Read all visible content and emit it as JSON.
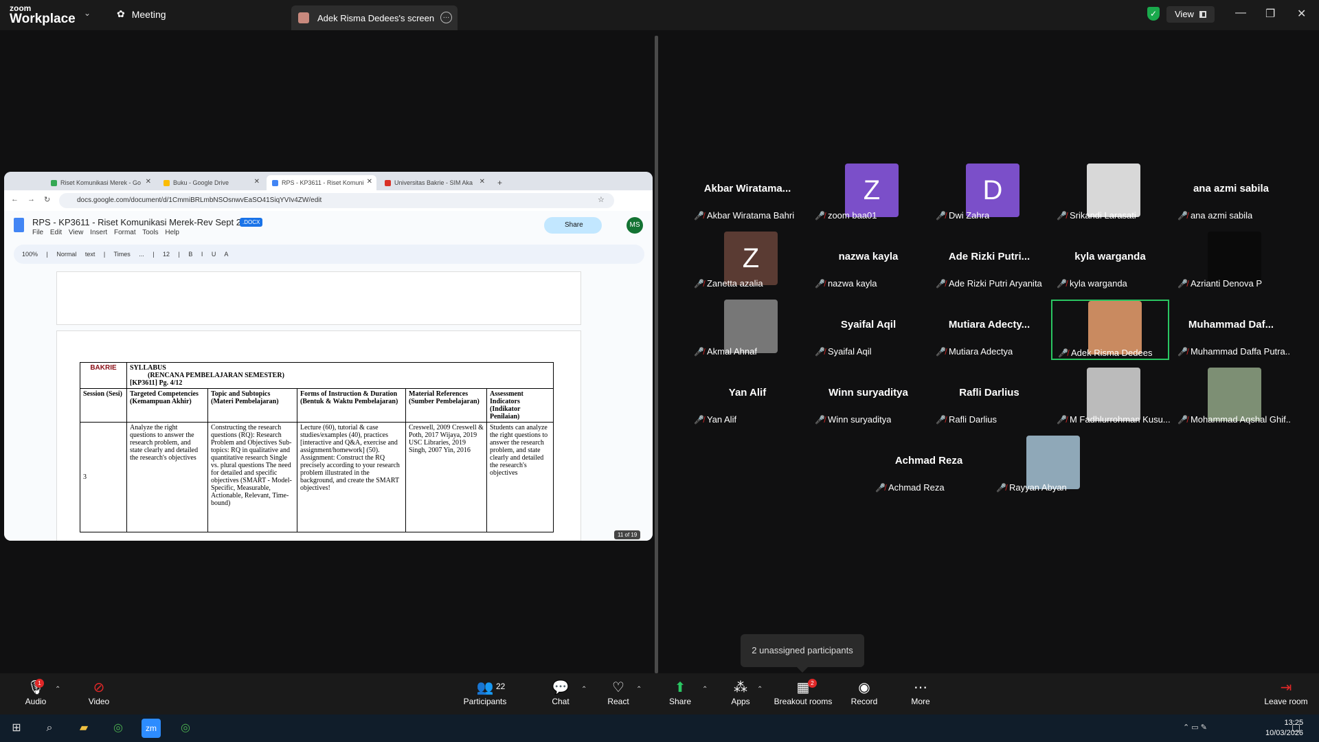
{
  "titlebar": {
    "logo_top": "zoom",
    "logo_bottom": "Workplace",
    "meeting_tab": "Meeting",
    "screen_tab": "Adek Risma Dedees's screen",
    "view_label": "View"
  },
  "browser": {
    "tabs": [
      "Riset Komunikasi Merek - Go",
      "Buku - Google Drive",
      "RPS - KP3611 - Riset Komuni",
      "Universitas Bakrie - SIM Aka"
    ],
    "url": "docs.google.com/document/d/1CmmiBRLmbNSOsnwvEaSO41SiqYVIv4ZW/edit"
  },
  "doc": {
    "title": "RPS - KP3611 - Riset Komunikasi Merek-Rev Sept 2025",
    "badge": ".DOCX",
    "menus": "File Edit View Insert Format Tools Help",
    "share_label": "Share",
    "avatar": "MS",
    "toolbar": "100% | Normal text | Times ... | 12 | B I U A",
    "page_count": "11 of 19",
    "syllabus": {
      "logo_text": "BAKRIE",
      "heading1": "SYLLABUS",
      "heading2": "(RENCANA PEMBELAJARAN SEMESTER)",
      "heading3": "[KP3611] Pg. 4/12",
      "headers": [
        "Session (Sesi)",
        "Targeted Competencies (Kemampuan Akhir)",
        "Topic and Subtopics (Materi Pembelajaran)",
        "Forms of Instruction & Duration (Bentuk & Waktu Pembelajaran)",
        "Material References (Sumber Pembelajaran)",
        "Assessment Indicators (Indikator Penilaian)"
      ],
      "row": [
        "3",
        "Analyze the right questions to answer the research problem, and state clearly and detailed the research's objectives",
        "Constructing the research questions (RQ): Research Problem and Objectives Sub-topics: RQ in qualitative and quantitative research Single vs. plural questions The need for detailed and specific objectives (SMART - Model-Specific, Measurable, Actionable, Relevant, Time-bound)",
        "Lecture (60), tutorial & case studies/examples (40), practices [interactive and Q&A, exercise and assignment/homework] (50). Assignment: Construct the RQ precisely according to your research problem illustrated in the background, and create the SMART objectives!",
        "Creswell, 2009 Creswell & Poth, 2017 Wijaya, 2019 USC Libraries, 2019 Singh, 2007 Yin, 2016",
        "Students can analyze the right questions to answer the research problem, and state clearly and detailed the research's objectives"
      ]
    }
  },
  "participants": [
    {
      "display": "Akbar  Wiratama...",
      "label": "Akbar Wiratama Bahri"
    },
    {
      "display": "Z",
      "label": "zoom baa01",
      "color": "#7b4fc9"
    },
    {
      "display": "D",
      "label": "Dwi Zahra",
      "color": "#7b4fc9"
    },
    {
      "display": "",
      "label": "Srikandi Larasati",
      "color": "#d8d8d8"
    },
    {
      "display": "ana azmi sabila",
      "label": "ana azmi sabila"
    },
    {
      "display": "Z",
      "label": "Zanetta azalia",
      "color": "#5a3b33"
    },
    {
      "display": "nazwa kayla",
      "label": "nazwa kayla"
    },
    {
      "display": "Ade  Rizki  Putri...",
      "label": "Ade Rizki Putri Aryanita"
    },
    {
      "display": "kyla warganda",
      "label": "kyla warganda"
    },
    {
      "display": "",
      "label": "Azrianti Denova P",
      "color": "#0a0a0a"
    },
    {
      "display": "",
      "label": "Akmal Ahnaf",
      "color": "#777"
    },
    {
      "display": "Syaifal Aqil",
      "label": "Syaifal Aqil"
    },
    {
      "display": "Mutiara  Adecty...",
      "label": "Mutiara Adectya"
    },
    {
      "display": "",
      "label": "Adek Risma Dedees",
      "color": "#c98a60"
    },
    {
      "display": "Muhammad  Daf...",
      "label": "Muhammad Daffa Putra..."
    },
    {
      "display": "Yan Alif",
      "label": "Yan Alif"
    },
    {
      "display": "Winn suryaditya",
      "label": "Winn suryaditya"
    },
    {
      "display": "Rafli Darlius",
      "label": "Rafli Darlius"
    },
    {
      "display": "",
      "label": "M Fadhlurrohman Kusu...",
      "color": "#bbb"
    },
    {
      "display": "",
      "label": "Mohammad Aqshal Ghif...",
      "color": "#7d8f74"
    },
    {
      "display": "Achmad Reza",
      "label": "Achmad Reza"
    },
    {
      "display": "",
      "label": "Rayyan Abyan",
      "color": "#8fa8b8"
    }
  ],
  "tooltip": "2 unassigned participants",
  "controls": {
    "audio": "Audio",
    "video": "Video",
    "participants": "Participants",
    "participants_count": "22",
    "chat": "Chat",
    "react": "React",
    "share": "Share",
    "apps": "Apps",
    "breakout": "Breakout rooms",
    "breakout_badge": "2",
    "record": "Record",
    "more": "More",
    "leave": "Leave room",
    "audio_badge": "1"
  },
  "clock": {
    "time": "13:25",
    "date": "10/03/2026"
  }
}
